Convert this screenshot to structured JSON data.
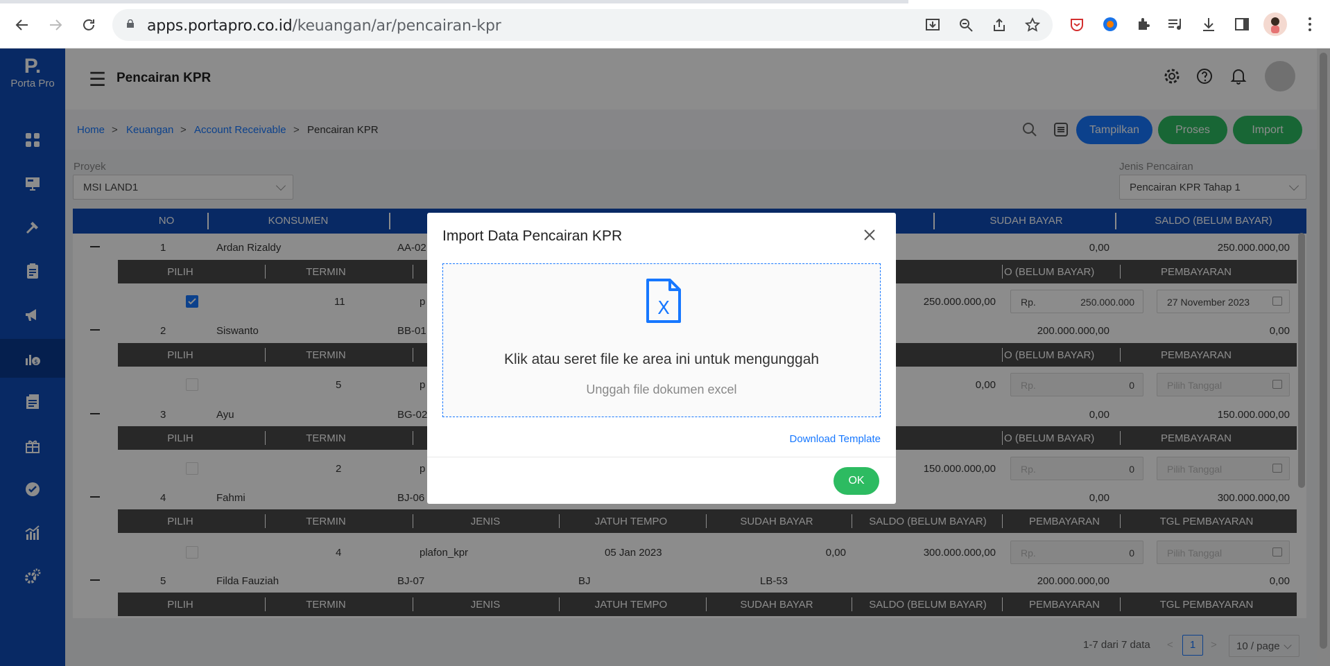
{
  "browser": {
    "url_host": "apps.portapro.co.id",
    "url_path": "/keuangan/ar/pencairan-kpr"
  },
  "app": {
    "logo_mark": "P.",
    "logo_text": "Porta Pro",
    "page_title": "Pencairan KPR"
  },
  "breadcrumb": {
    "home": "Home",
    "keuangan": "Keuangan",
    "ar": "Account Receivable",
    "current": "Pencairan KPR",
    "sep": ">"
  },
  "actions": {
    "tampilkan": "Tampilkan",
    "proses": "Proses",
    "import": "Import"
  },
  "filters": {
    "proyek_label": "Proyek",
    "proyek_value": "MSI LAND1",
    "jenis_label": "Jenis Pencairan",
    "jenis_value": "Pencairan KPR Tahap 1"
  },
  "table": {
    "headers": [
      "NO",
      "KONSUMEN",
      "SUDAH BAYAR",
      "SALDO (BELUM BAYAR)"
    ],
    "sub_headers": [
      "PILIH",
      "TERMIN",
      "JENIS",
      "JATUH TEMPO",
      "SUDAH BAYAR",
      "SALDO (BELUM BAYAR)",
      "PEMBAYARAN",
      "TGL PEMBAYARAN"
    ],
    "sub_header_partial": "O (BELUM BAYAR)",
    "rows": [
      {
        "no": "1",
        "konsumen": "Ardan Rizaldy",
        "unit": "AA-02",
        "sudah": "0,00",
        "saldo": "250.000.000,00",
        "sub": {
          "termin": "11",
          "jenis": "p",
          "saldo": "250.000.000,00",
          "rp": "Rp.",
          "bayar": "250.000.000",
          "tgl": "27 November 2023",
          "checked": true
        }
      },
      {
        "no": "2",
        "konsumen": "Siswanto",
        "unit": "BB-01",
        "sudah": "200.000.000,00",
        "saldo": "0,00",
        "sub": {
          "termin": "5",
          "jenis": "p",
          "saldo": "0,00",
          "rp": "Rp.",
          "bayar": "0",
          "tgl": "Pilih Tanggal",
          "checked": false
        }
      },
      {
        "no": "3",
        "konsumen": "Ayu",
        "unit": "BG-02",
        "sudah": "0,00",
        "saldo": "150.000.000,00",
        "sub": {
          "termin": "2",
          "jenis": "p",
          "saldo": "150.000.000,00",
          "rp": "Rp.",
          "bayar": "0",
          "tgl": "Pilih Tanggal",
          "checked": false
        }
      },
      {
        "no": "4",
        "konsumen": "Fahmi",
        "unit": "BJ-06",
        "sudah": "0,00",
        "saldo": "300.000.000,00",
        "sub": {
          "termin": "4",
          "jenis": "plafon_kpr",
          "jatuh": "05 Jan 2023",
          "sudah": "0,00",
          "saldo": "300.000.000,00",
          "rp": "Rp.",
          "bayar": "0",
          "tgl": "Pilih Tanggal",
          "checked": false
        }
      },
      {
        "no": "5",
        "konsumen": "Filda Fauziah",
        "unit": "BJ-07",
        "tipe": "BJ",
        "blok": "LB-53",
        "sudah": "200.000.000,00",
        "saldo": "0,00"
      }
    ]
  },
  "pagination": {
    "summary": "1-7 dari 7 data",
    "prev": "<",
    "page": "1",
    "next": ">",
    "page_size": "10 / page"
  },
  "modal": {
    "title": "Import Data Pencairan KPR",
    "drop_main": "Klik atau seret file ke area ini untuk mengunggah",
    "drop_sub": "Unggah file dokumen excel",
    "file_icon_letter": "X",
    "download_template": "Download Template",
    "ok": "OK"
  },
  "colors": {
    "sidebar": "#0f4cb7",
    "primary": "#1677ff",
    "tampilkan": "#1677ff",
    "proses": "#2dbb61",
    "import": "#2dbb61"
  }
}
